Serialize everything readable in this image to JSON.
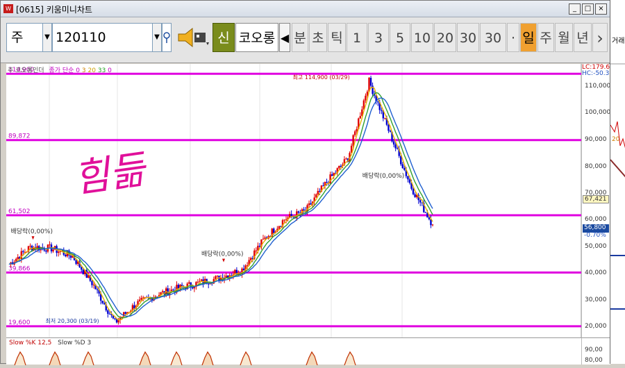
{
  "window": {
    "title": "[0615] 키움미니차트",
    "icon_text": "W",
    "controls": {
      "minimize": "_",
      "restore": "□",
      "close": "×"
    }
  },
  "toolbar": {
    "market_type": "주",
    "stock_code": "120110",
    "new_label": "신",
    "market_label": "코오롱",
    "interval_labels": [
      "분",
      "초",
      "틱"
    ],
    "period_numbers": [
      "1",
      "3",
      "5",
      "10",
      "20",
      "30",
      "30"
    ],
    "period_dropdown": "·",
    "timeframes": [
      "일",
      "주",
      "월",
      "년"
    ],
    "active_timeframe": "일",
    "next": "›"
  },
  "chart": {
    "legend_prefix": "주",
    "legend_name": "코오롱인더",
    "legend_ma": "종가 단순",
    "ma_periods": [
      "0",
      "3",
      "20",
      "33",
      "0"
    ],
    "ma_colors": [
      "#c000c0",
      "#d08000",
      "#20a020",
      "#1a7ad0",
      "#c000c0"
    ],
    "lc_label": "LC:179.6",
    "hc_label": "HC:-50.3",
    "top_line_label": "114,900",
    "high_annotation": "최고 114,900 (03/29)",
    "low_annotation": "최저 20,300 (03/19)",
    "fib_levels": [
      "89,872",
      "61,502",
      "39,866",
      "19,600"
    ],
    "dividend_labels": [
      "배당락(0,00%)",
      "배당락(0,00%)",
      "배당락(0,00%)"
    ],
    "current_price": "67,421",
    "price_box": "56,800",
    "price_change": "-0.70%",
    "y_ticks": [
      "110,000",
      "100,000",
      "90,000",
      "80,000",
      "70,000",
      "60,000",
      "50,000",
      "40,000",
      "30,000",
      "20,000"
    ],
    "handwriting": "힘듦",
    "colors": {
      "fib": "#e000e0",
      "up": "#e00000",
      "down": "#0000d0",
      "ma_short": "#e8b000",
      "ma_mid": "#30a030",
      "ma_long": "#2060d0"
    }
  },
  "stochastic": {
    "label_k": "Slow %K 12,5",
    "label_d": "Slow %D 3",
    "y_ticks": [
      "90,00",
      "80,00"
    ]
  },
  "right_panel": {
    "label": "거래",
    "value": "20"
  },
  "chart_data": {
    "type": "candlestick",
    "ylim": [
      18000,
      116000
    ],
    "x": [
      0,
      5,
      10,
      15,
      20,
      25,
      30,
      35,
      40,
      45,
      50,
      55,
      60,
      65,
      70,
      75,
      80,
      85,
      90,
      95,
      100
    ],
    "close": [
      43000,
      49500,
      49000,
      46000,
      35000,
      21000,
      28000,
      31500,
      34000,
      36000,
      38000,
      41000,
      52000,
      60000,
      63000,
      74000,
      83000,
      112000,
      92000,
      72000,
      58000
    ],
    "levels": [
      {
        "label": "114,900",
        "value": 114900
      },
      {
        "label": "89,872",
        "value": 89872
      },
      {
        "label": "61,502",
        "value": 61502
      },
      {
        "label": "39,866",
        "value": 39866
      },
      {
        "label": "19,600",
        "value": 19600
      }
    ]
  }
}
